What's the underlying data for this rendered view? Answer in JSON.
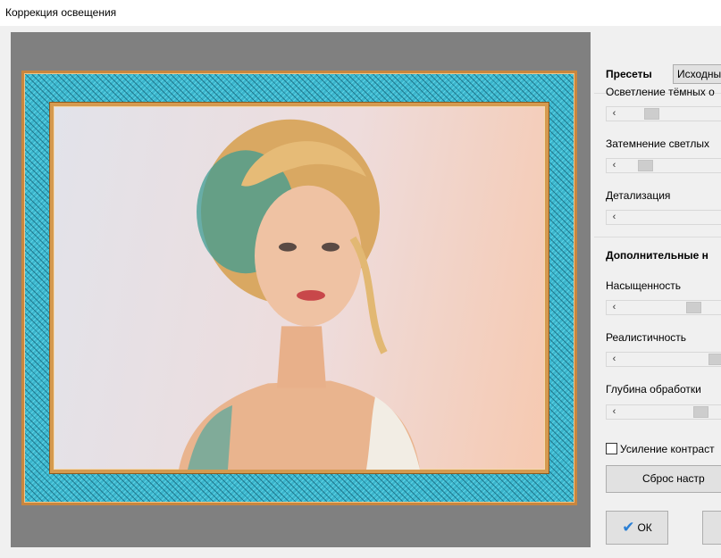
{
  "window": {
    "title": "Коррекция освещения"
  },
  "presets": {
    "label": "Пресеты",
    "value": "Исходный"
  },
  "sliders_main": [
    {
      "label": "Осветление тёмных о",
      "value": 0.25
    },
    {
      "label": "Затемнение светлых",
      "value": 0.18
    },
    {
      "label": "Детализация",
      "value": 0.0
    }
  ],
  "advanced": {
    "heading": "Дополнительные н"
  },
  "sliders_advanced": [
    {
      "label": "Насыщенность",
      "value": 0.72
    },
    {
      "label": "Реалистичность",
      "value": 0.97
    },
    {
      "label": "Глубина обработки",
      "value": 0.8
    }
  ],
  "contrast_checkbox": {
    "label": "Усиление контраст",
    "checked": false
  },
  "buttons": {
    "reset": "Сброс настр",
    "ok": "ОК"
  },
  "icons": {
    "slider_left": "‹",
    "ok_check": "✔"
  },
  "colors": {
    "frame_teal": "#3bb5cc",
    "frame_gold": "#c9863d",
    "preview_bg": "#808080"
  }
}
